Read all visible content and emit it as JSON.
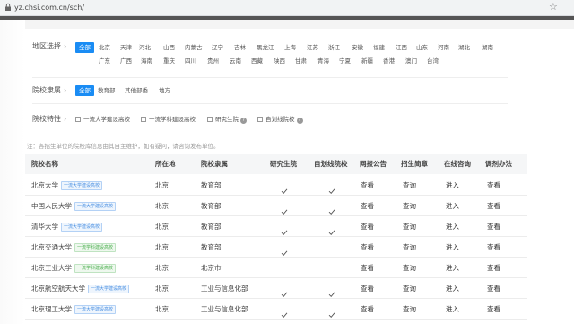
{
  "browser": {
    "url": "yz.chsi.com.cn/sch/"
  },
  "filters": {
    "region": {
      "label": "地区选择",
      "all_label": "全部",
      "row1": [
        "北京",
        "天津",
        "河北",
        "山西",
        "内蒙古",
        "辽宁",
        "吉林",
        "黑龙江",
        "上海",
        "江苏",
        "浙江",
        "安徽",
        "福建",
        "江西",
        "山东",
        "河南",
        "湖北",
        "湖南"
      ],
      "row2": [
        "广东",
        "广西",
        "海南",
        "重庆",
        "四川",
        "贵州",
        "云南",
        "西藏",
        "陕西",
        "甘肃",
        "青海",
        "宁夏",
        "新疆",
        "香港",
        "澳门",
        "台湾"
      ]
    },
    "affiliation": {
      "label": "院校隶属",
      "options": [
        "全部",
        "教育部",
        "其他部委",
        "地方"
      ]
    },
    "features": {
      "label": "院校特性",
      "options": [
        "一流大学建设高校",
        "一流学科建设高校",
        "研究生院",
        "自划线院校"
      ]
    }
  },
  "note": "注：各招生单位的院校库信息由其自主维护，如有疑问，请咨询发布单位。",
  "table": {
    "headers": [
      "院校名称",
      "所在地",
      "院校隶属",
      "研究生院",
      "自划线院校",
      "网报公告",
      "招生简章",
      "在线咨询",
      "调剂办法"
    ],
    "rows": [
      {
        "name": "北京大学",
        "tag": "一流大学建设高校",
        "tag_color": "blue",
        "location": "北京",
        "affiliation": "教育部",
        "grad_school": true,
        "self_line": true,
        "notice": "查看",
        "brochure": "查询",
        "consult": "进入",
        "adjust": "查看"
      },
      {
        "name": "中国人民大学",
        "tag": "一流大学建设高校",
        "tag_color": "blue",
        "location": "北京",
        "affiliation": "教育部",
        "grad_school": true,
        "self_line": true,
        "notice": "查看",
        "brochure": "查询",
        "consult": "进入",
        "adjust": "查看"
      },
      {
        "name": "清华大学",
        "tag": "一流大学建设高校",
        "tag_color": "blue",
        "location": "北京",
        "affiliation": "教育部",
        "grad_school": true,
        "self_line": true,
        "notice": "查看",
        "brochure": "查询",
        "consult": "进入",
        "adjust": "查看"
      },
      {
        "name": "北京交通大学",
        "tag": "一流学科建设高校",
        "tag_color": "green",
        "location": "北京",
        "affiliation": "教育部",
        "grad_school": true,
        "self_line": false,
        "notice": "查看",
        "brochure": "查询",
        "consult": "进入",
        "adjust": "查看"
      },
      {
        "name": "北京工业大学",
        "tag": "一流学科建设高校",
        "tag_color": "green",
        "location": "北京",
        "affiliation": "北京市",
        "grad_school": false,
        "self_line": false,
        "notice": "查看",
        "brochure": "查询",
        "consult": "进入",
        "adjust": "查看"
      },
      {
        "name": "北京航空航天大学",
        "tag": "一流大学建设高校",
        "tag_color": "blue",
        "location": "北京",
        "affiliation": "工业与信息化部",
        "grad_school": true,
        "self_line": true,
        "notice": "查看",
        "brochure": "查询",
        "consult": "进入",
        "adjust": "查看"
      },
      {
        "name": "北京理工大学",
        "tag": "一流大学建设高校",
        "tag_color": "blue",
        "location": "北京",
        "affiliation": "工业与信息化部",
        "grad_school": true,
        "self_line": true,
        "notice": "查看",
        "brochure": "查询",
        "consult": "进入",
        "adjust": "查看"
      }
    ]
  },
  "colors": {
    "accent": "#1a8cf4",
    "tag_blue": "#4a90e2",
    "tag_green": "#4caf50"
  }
}
